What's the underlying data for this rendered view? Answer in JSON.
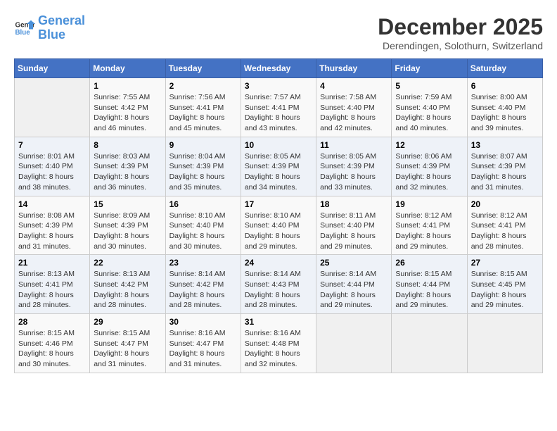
{
  "header": {
    "logo_line1": "General",
    "logo_line2": "Blue",
    "month": "December 2025",
    "location": "Derendingen, Solothurn, Switzerland"
  },
  "days_of_week": [
    "Sunday",
    "Monday",
    "Tuesday",
    "Wednesday",
    "Thursday",
    "Friday",
    "Saturday"
  ],
  "weeks": [
    [
      {
        "day": "",
        "info": ""
      },
      {
        "day": "1",
        "info": "Sunrise: 7:55 AM\nSunset: 4:42 PM\nDaylight: 8 hours\nand 46 minutes."
      },
      {
        "day": "2",
        "info": "Sunrise: 7:56 AM\nSunset: 4:41 PM\nDaylight: 8 hours\nand 45 minutes."
      },
      {
        "day": "3",
        "info": "Sunrise: 7:57 AM\nSunset: 4:41 PM\nDaylight: 8 hours\nand 43 minutes."
      },
      {
        "day": "4",
        "info": "Sunrise: 7:58 AM\nSunset: 4:40 PM\nDaylight: 8 hours\nand 42 minutes."
      },
      {
        "day": "5",
        "info": "Sunrise: 7:59 AM\nSunset: 4:40 PM\nDaylight: 8 hours\nand 40 minutes."
      },
      {
        "day": "6",
        "info": "Sunrise: 8:00 AM\nSunset: 4:40 PM\nDaylight: 8 hours\nand 39 minutes."
      }
    ],
    [
      {
        "day": "7",
        "info": "Sunrise: 8:01 AM\nSunset: 4:40 PM\nDaylight: 8 hours\nand 38 minutes."
      },
      {
        "day": "8",
        "info": "Sunrise: 8:03 AM\nSunset: 4:39 PM\nDaylight: 8 hours\nand 36 minutes."
      },
      {
        "day": "9",
        "info": "Sunrise: 8:04 AM\nSunset: 4:39 PM\nDaylight: 8 hours\nand 35 minutes."
      },
      {
        "day": "10",
        "info": "Sunrise: 8:05 AM\nSunset: 4:39 PM\nDaylight: 8 hours\nand 34 minutes."
      },
      {
        "day": "11",
        "info": "Sunrise: 8:05 AM\nSunset: 4:39 PM\nDaylight: 8 hours\nand 33 minutes."
      },
      {
        "day": "12",
        "info": "Sunrise: 8:06 AM\nSunset: 4:39 PM\nDaylight: 8 hours\nand 32 minutes."
      },
      {
        "day": "13",
        "info": "Sunrise: 8:07 AM\nSunset: 4:39 PM\nDaylight: 8 hours\nand 31 minutes."
      }
    ],
    [
      {
        "day": "14",
        "info": "Sunrise: 8:08 AM\nSunset: 4:39 PM\nDaylight: 8 hours\nand 31 minutes."
      },
      {
        "day": "15",
        "info": "Sunrise: 8:09 AM\nSunset: 4:39 PM\nDaylight: 8 hours\nand 30 minutes."
      },
      {
        "day": "16",
        "info": "Sunrise: 8:10 AM\nSunset: 4:40 PM\nDaylight: 8 hours\nand 30 minutes."
      },
      {
        "day": "17",
        "info": "Sunrise: 8:10 AM\nSunset: 4:40 PM\nDaylight: 8 hours\nand 29 minutes."
      },
      {
        "day": "18",
        "info": "Sunrise: 8:11 AM\nSunset: 4:40 PM\nDaylight: 8 hours\nand 29 minutes."
      },
      {
        "day": "19",
        "info": "Sunrise: 8:12 AM\nSunset: 4:41 PM\nDaylight: 8 hours\nand 29 minutes."
      },
      {
        "day": "20",
        "info": "Sunrise: 8:12 AM\nSunset: 4:41 PM\nDaylight: 8 hours\nand 28 minutes."
      }
    ],
    [
      {
        "day": "21",
        "info": "Sunrise: 8:13 AM\nSunset: 4:41 PM\nDaylight: 8 hours\nand 28 minutes."
      },
      {
        "day": "22",
        "info": "Sunrise: 8:13 AM\nSunset: 4:42 PM\nDaylight: 8 hours\nand 28 minutes."
      },
      {
        "day": "23",
        "info": "Sunrise: 8:14 AM\nSunset: 4:42 PM\nDaylight: 8 hours\nand 28 minutes."
      },
      {
        "day": "24",
        "info": "Sunrise: 8:14 AM\nSunset: 4:43 PM\nDaylight: 8 hours\nand 28 minutes."
      },
      {
        "day": "25",
        "info": "Sunrise: 8:14 AM\nSunset: 4:44 PM\nDaylight: 8 hours\nand 29 minutes."
      },
      {
        "day": "26",
        "info": "Sunrise: 8:15 AM\nSunset: 4:44 PM\nDaylight: 8 hours\nand 29 minutes."
      },
      {
        "day": "27",
        "info": "Sunrise: 8:15 AM\nSunset: 4:45 PM\nDaylight: 8 hours\nand 29 minutes."
      }
    ],
    [
      {
        "day": "28",
        "info": "Sunrise: 8:15 AM\nSunset: 4:46 PM\nDaylight: 8 hours\nand 30 minutes."
      },
      {
        "day": "29",
        "info": "Sunrise: 8:15 AM\nSunset: 4:47 PM\nDaylight: 8 hours\nand 31 minutes."
      },
      {
        "day": "30",
        "info": "Sunrise: 8:16 AM\nSunset: 4:47 PM\nDaylight: 8 hours\nand 31 minutes."
      },
      {
        "day": "31",
        "info": "Sunrise: 8:16 AM\nSunset: 4:48 PM\nDaylight: 8 hours\nand 32 minutes."
      },
      {
        "day": "",
        "info": ""
      },
      {
        "day": "",
        "info": ""
      },
      {
        "day": "",
        "info": ""
      }
    ]
  ]
}
